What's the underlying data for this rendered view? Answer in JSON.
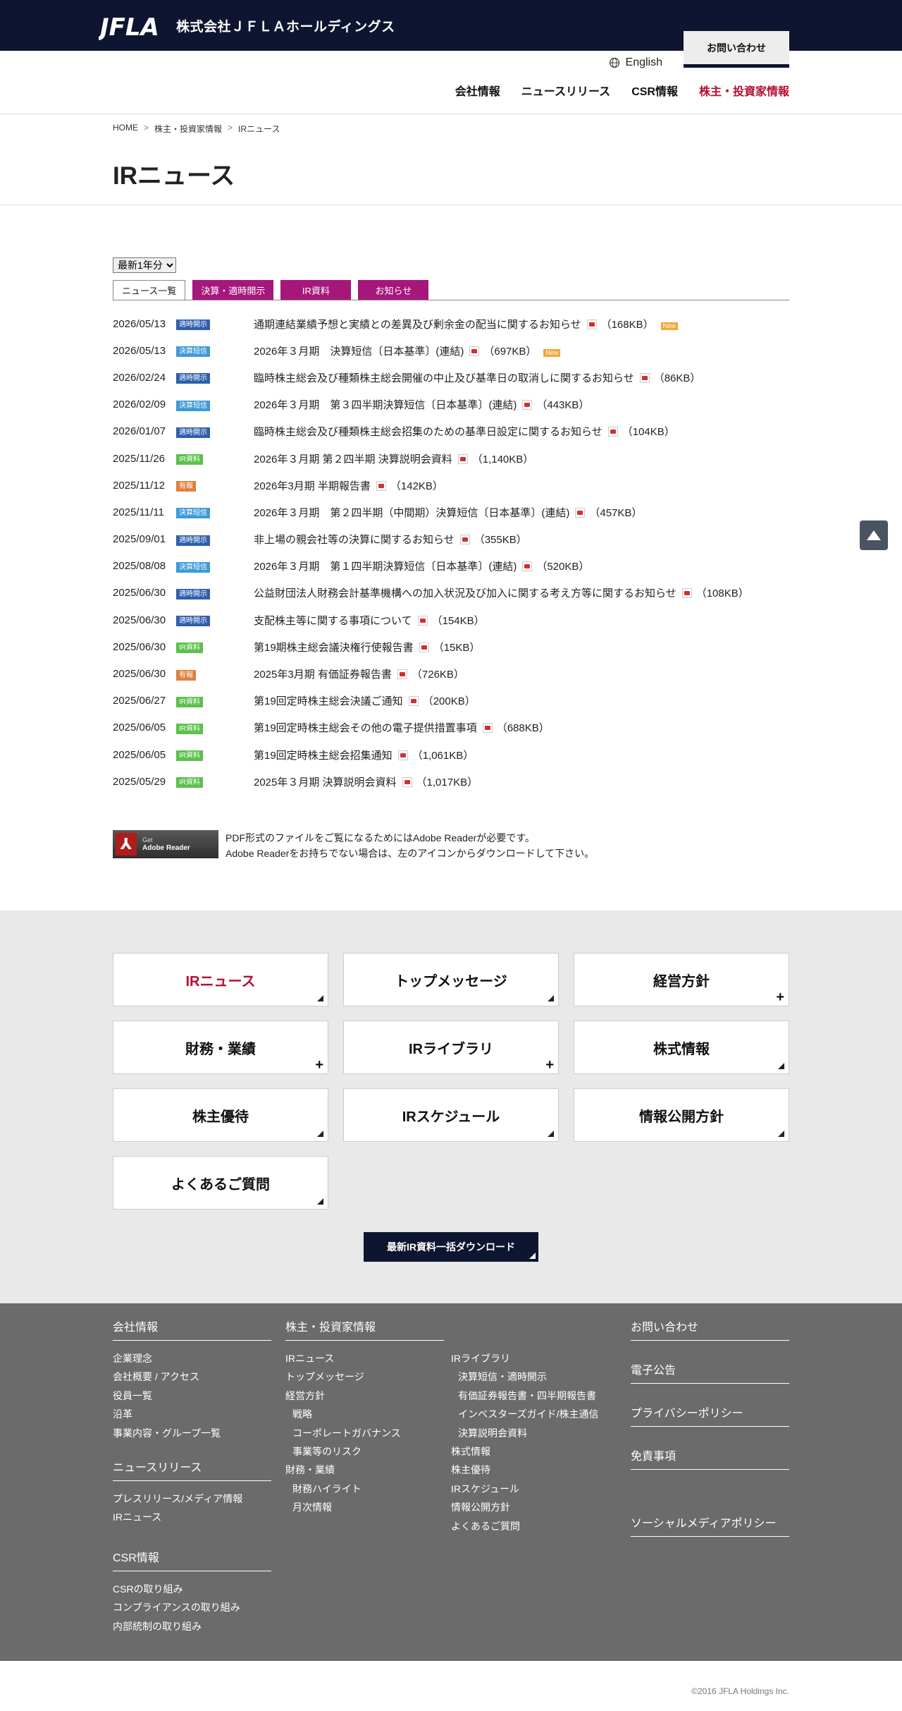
{
  "header": {
    "logo_text": "JFLA",
    "company": "株式会社ＪＦＬＡホールディングス",
    "contact": "お問い合わせ",
    "language": "English",
    "nav": [
      "会社情報",
      "ニュースリリース",
      "CSR情報",
      "株主・投資家情報"
    ]
  },
  "breadcrumb": [
    "HOME",
    "株主・投資家情報",
    "IRニュース"
  ],
  "page_title": "IRニュース",
  "filter": {
    "selected": "最新1年分"
  },
  "tabs": [
    "ニュース一覧",
    "決算・適時開示",
    "IR資料",
    "お知らせ"
  ],
  "news": [
    {
      "date": "2026/05/13",
      "badge": "適時開示",
      "type": "tekiji",
      "title": "通期連結業績予想と実績との差異及び剰余金の配当に関するお知らせ",
      "size": "（168KB）",
      "new": "New"
    },
    {
      "date": "2026/05/13",
      "badge": "決算短信",
      "type": "kessan",
      "title": "2026年３月期　決算短信〔日本基準〕(連結)",
      "size": "（697KB）",
      "new": "New"
    },
    {
      "date": "2026/02/24",
      "badge": "適時開示",
      "type": "tekiji",
      "title": "臨時株主総会及び種類株主総会開催の中止及び基準日の取消しに関するお知らせ",
      "size": "（86KB）"
    },
    {
      "date": "2026/02/09",
      "badge": "決算短信",
      "type": "kessan",
      "title": "2026年３月期　第３四半期決算短信〔日本基準〕(連結)",
      "size": "（443KB）"
    },
    {
      "date": "2026/01/07",
      "badge": "適時開示",
      "type": "tekiji",
      "title": "臨時株主総会及び種類株主総会招集のための基準日設定に関するお知らせ",
      "size": "（104KB）"
    },
    {
      "date": "2025/11/26",
      "badge": "IR資料",
      "type": "ir",
      "title": "2026年３月期 第２四半期 決算説明会資料",
      "size": "（1,140KB）"
    },
    {
      "date": "2025/11/12",
      "badge": "有報",
      "type": "yuho",
      "title": "2026年3月期 半期報告書",
      "size": "（142KB）"
    },
    {
      "date": "2025/11/11",
      "badge": "決算短信",
      "type": "kessan",
      "title": "2026年３月期　第２四半期（中間期）決算短信〔日本基準〕(連結)",
      "size": "（457KB）"
    },
    {
      "date": "2025/09/01",
      "badge": "適時開示",
      "type": "tekiji",
      "title": "非上場の親会社等の決算に関するお知らせ",
      "size": "（355KB）"
    },
    {
      "date": "2025/08/08",
      "badge": "決算短信",
      "type": "kessan",
      "title": "2026年３月期　第１四半期決算短信〔日本基準〕(連結)",
      "size": "（520KB）"
    },
    {
      "date": "2025/06/30",
      "badge": "適時開示",
      "type": "tekiji",
      "title": "公益財団法人財務会計基準機構への加入状況及び加入に関する考え方等に関するお知らせ",
      "size": "（108KB）"
    },
    {
      "date": "2025/06/30",
      "badge": "適時開示",
      "type": "tekiji",
      "title": "支配株主等に関する事項について",
      "size": "（154KB）"
    },
    {
      "date": "2025/06/30",
      "badge": "IR資料",
      "type": "ir",
      "title": "第19期株主総会議決権行使報告書",
      "size": "（15KB）"
    },
    {
      "date": "2025/06/30",
      "badge": "有報",
      "type": "yuho",
      "title": "2025年3月期 有価証券報告書",
      "size": "（726KB）"
    },
    {
      "date": "2025/06/27",
      "badge": "IR資料",
      "type": "ir",
      "title": "第19回定時株主総会決議ご通知",
      "size": "（200KB）"
    },
    {
      "date": "2025/06/05",
      "badge": "IR資料",
      "type": "ir",
      "title": "第19回定時株主総会その他の電子提供措置事項",
      "size": "（688KB）"
    },
    {
      "date": "2025/06/05",
      "badge": "IR資料",
      "type": "ir",
      "title": "第19回定時株主総会招集通知",
      "size": "（1,061KB）"
    },
    {
      "date": "2025/05/29",
      "badge": "IR資料",
      "type": "ir",
      "title": "2025年３月期 決算説明会資料",
      "size": "（1,017KB）"
    }
  ],
  "adobe": {
    "badge_get": "Get",
    "badge_name": "Adobe Reader",
    "line1": "PDF形式のファイルをご覧になるためにはAdobe Readerが必要です。",
    "line2": "Adobe Readerをお持ちでない場合は、左のアイコンからダウンロードして下さい。"
  },
  "menu_cards": [
    {
      "label": "IRニュース",
      "mark": "corner",
      "active": true
    },
    {
      "label": "トップメッセージ",
      "mark": "corner"
    },
    {
      "label": "経営方針",
      "mark": "plus"
    },
    {
      "label": "財務・業績",
      "mark": "plus"
    },
    {
      "label": "IRライブラリ",
      "mark": "plus"
    },
    {
      "label": "株式情報",
      "mark": "corner"
    },
    {
      "label": "株主優待",
      "mark": "corner"
    },
    {
      "label": "IRスケジュール",
      "mark": "corner"
    },
    {
      "label": "情報公開方針",
      "mark": "corner"
    },
    {
      "label": "よくあるご質問",
      "mark": "corner"
    }
  ],
  "download_button": "最新IR資料一括ダウンロード",
  "footer": {
    "col1": [
      {
        "head": "会社情報",
        "links": [
          "企業理念",
          "会社概要 / アクセス",
          "役員一覧",
          "沿革",
          "事業内容・グループ一覧"
        ]
      },
      {
        "head": "ニュースリリース",
        "links": [
          "プレスリリース/メディア情報",
          "IRニュース"
        ]
      },
      {
        "head": "CSR情報",
        "links": [
          "CSRの取り組み",
          "コンプライアンスの取り組み",
          "内部統制の取り組み"
        ]
      }
    ],
    "col2_head": "株主・投資家情報",
    "col2": [
      {
        "t": "IRニュース"
      },
      {
        "t": "トップメッセージ"
      },
      {
        "t": "経営方針"
      },
      {
        "t": "戦略",
        "i": true
      },
      {
        "t": "コーポレートガバナンス",
        "i": true
      },
      {
        "t": "事業等のリスク",
        "i": true
      },
      {
        "t": "財務・業績"
      },
      {
        "t": "財務ハイライト",
        "i": true
      },
      {
        "t": "月次情報",
        "i": true
      }
    ],
    "col3": [
      {
        "t": "IRライブラリ"
      },
      {
        "t": "決算短信・適時開示",
        "i": true
      },
      {
        "t": "有価証券報告書・四半期報告書",
        "i": true
      },
      {
        "t": "インベスターズガイド/株主通信",
        "i": true
      },
      {
        "t": "決算説明会資料",
        "i": true
      },
      {
        "t": "株式情報"
      },
      {
        "t": "株主優待"
      },
      {
        "t": "IRスケジュール"
      },
      {
        "t": "情報公開方針"
      },
      {
        "t": "よくあるご質問"
      }
    ],
    "col4": [
      "お問い合わせ",
      "電子公告",
      "プライバシーポリシー",
      "免責事項",
      "ソーシャルメディアポリシー"
    ]
  },
  "copyright": "©2016 JFLA Holdings Inc.",
  "colors": {
    "navy": "#0e1530",
    "accent_red": "#b40e32",
    "tab_magenta": "#a5177b"
  }
}
